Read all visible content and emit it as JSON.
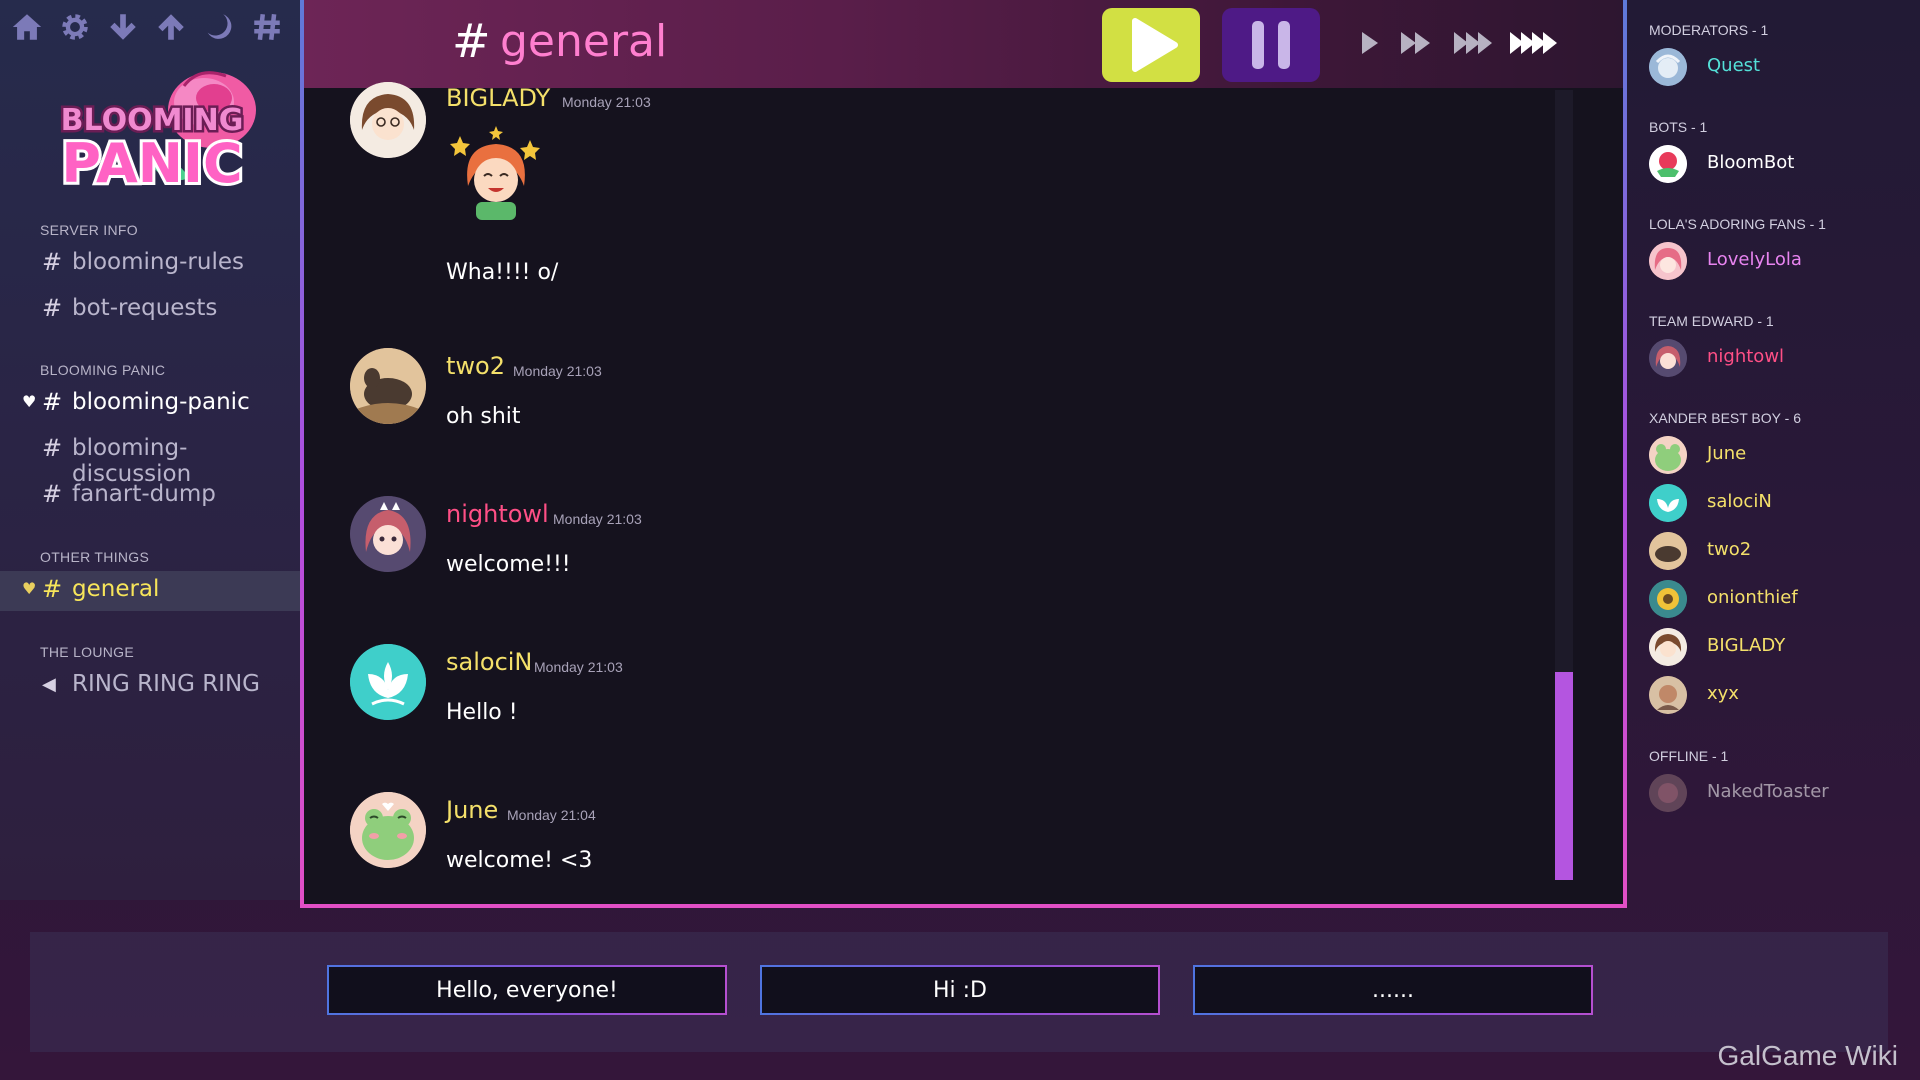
{
  "toolbar": {
    "icons": [
      "home-icon",
      "gear-icon",
      "arrow-down-icon",
      "arrow-up-icon",
      "moon-icon",
      "hash-icon"
    ]
  },
  "logo": {
    "line1": "BLOOMING",
    "line2": "PANIC"
  },
  "sidebar": {
    "categories": [
      {
        "label": "SERVER INFO",
        "channels": [
          {
            "name": "blooming-rules",
            "glyph": "#"
          },
          {
            "name": "bot-requests",
            "glyph": "#"
          }
        ]
      },
      {
        "label": "BLOOMING PANIC",
        "channels": [
          {
            "name": "blooming-panic",
            "glyph": "#",
            "heart": "♥"
          },
          {
            "name": "blooming-discussion",
            "glyph": "#"
          },
          {
            "name": "fanart-dump",
            "glyph": "#"
          }
        ]
      },
      {
        "label": "OTHER THINGS",
        "channels": [
          {
            "name": "general",
            "glyph": "#",
            "heart": "♥"
          }
        ]
      },
      {
        "label": "THE LOUNGE",
        "channels": [
          {
            "name": "RING RING RING",
            "glyph": "◀"
          }
        ]
      }
    ]
  },
  "chat": {
    "hash": "#",
    "title": "general",
    "messages": [
      {
        "author": "BIGLADY",
        "time": "Monday 21:03",
        "text": "Wha!!!! o/",
        "author_color": "#f4e06a"
      },
      {
        "author": "two2",
        "time": "Monday 21:03",
        "text": "oh shit",
        "author_color": "#f4e06a"
      },
      {
        "author": "nightowl",
        "time": "Monday 21:03",
        "text": "welcome!!!",
        "author_color": "#ff4f86"
      },
      {
        "author": "salociN",
        "time": "Monday 21:03",
        "text": "Hello !",
        "author_color": "#f4e06a"
      },
      {
        "author": "June",
        "time": "Monday 21:04",
        "text": "welcome! <3",
        "author_color": "#f4e06a"
      }
    ]
  },
  "members": {
    "groups": [
      {
        "label": "MODERATORS - 1",
        "members": [
          {
            "name": "Quest",
            "color": "#54e0d8"
          }
        ]
      },
      {
        "label": "BOTS - 1",
        "members": [
          {
            "name": "BloomBot",
            "color": "#ffffff"
          }
        ]
      },
      {
        "label": "LOLA'S ADORING FANS - 1",
        "members": [
          {
            "name": "LovelyLola",
            "color": "#e884f0"
          }
        ]
      },
      {
        "label": "TEAM EDWARD - 1",
        "members": [
          {
            "name": "nightowl",
            "color": "#ff4f86"
          }
        ]
      },
      {
        "label": "XANDER BEST BOY - 6",
        "members": [
          {
            "name": "June",
            "color": "#f4e06a"
          },
          {
            "name": "salociN",
            "color": "#f4e06a"
          },
          {
            "name": "two2",
            "color": "#f4e06a"
          },
          {
            "name": "onionthief",
            "color": "#f4e06a"
          },
          {
            "name": "BIGLADY",
            "color": "#f4e06a"
          },
          {
            "name": "xyx",
            "color": "#f4e06a"
          }
        ]
      },
      {
        "label": "OFFLINE - 1",
        "members": [
          {
            "name": "NakedToaster",
            "color": "#ffffff"
          }
        ]
      }
    ]
  },
  "choices": [
    "Hello, everyone!",
    "Hi :D",
    "......"
  ],
  "watermark": "GalGame Wiki"
}
